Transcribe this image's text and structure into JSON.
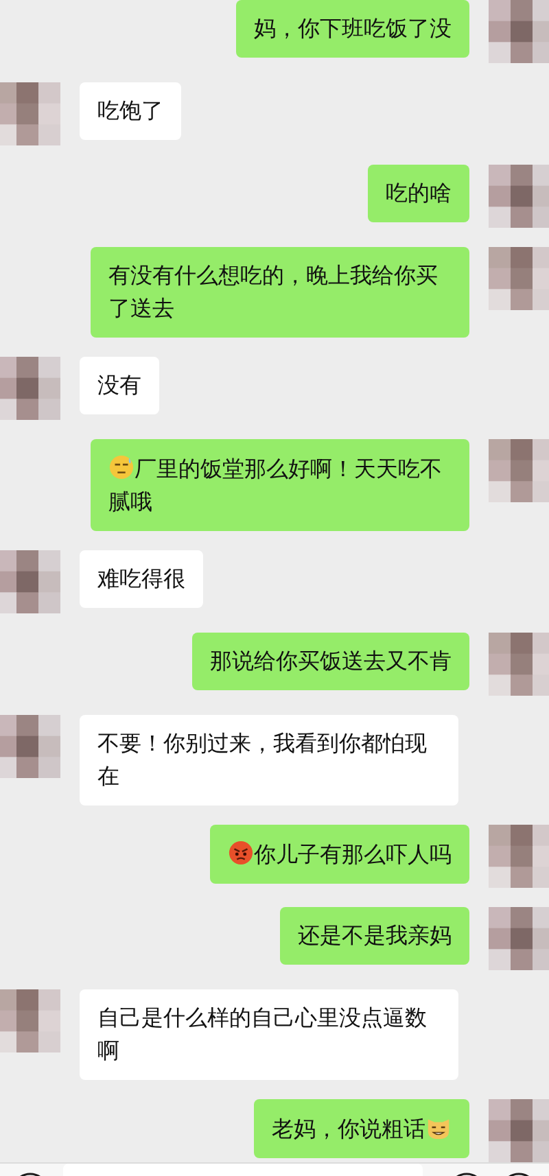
{
  "messages": [
    {
      "sent": true,
      "text": "妈，你下班吃饭了没"
    },
    {
      "sent": false,
      "text": "吃饱了"
    },
    {
      "sent": true,
      "text": "吃的啥"
    },
    {
      "sent": true,
      "text": "有没有什么想吃的，晚上我给你买了送去"
    },
    {
      "sent": false,
      "text": "没有"
    },
    {
      "sent": true,
      "text": "厂里的饭堂那么好啊！天天吃不腻哦",
      "emoji": {
        "kind": "sweat",
        "trailing": false
      }
    },
    {
      "sent": false,
      "text": "难吃得很"
    },
    {
      "sent": true,
      "text": "那说给你买饭送去又不肯"
    },
    {
      "sent": false,
      "text": "不要！你别过来，我看到你都怕现在"
    },
    {
      "sent": true,
      "text": "你儿子有那么吓人吗",
      "emoji": {
        "kind": "angry",
        "trailing": false
      }
    },
    {
      "sent": true,
      "text": "还是不是我亲妈"
    },
    {
      "sent": false,
      "text": "自己是什么样的自己心里没点逼数啊"
    },
    {
      "sent": true,
      "text": "老妈，你说粗话",
      "emoji": {
        "kind": "cat",
        "trailing": true
      }
    }
  ]
}
